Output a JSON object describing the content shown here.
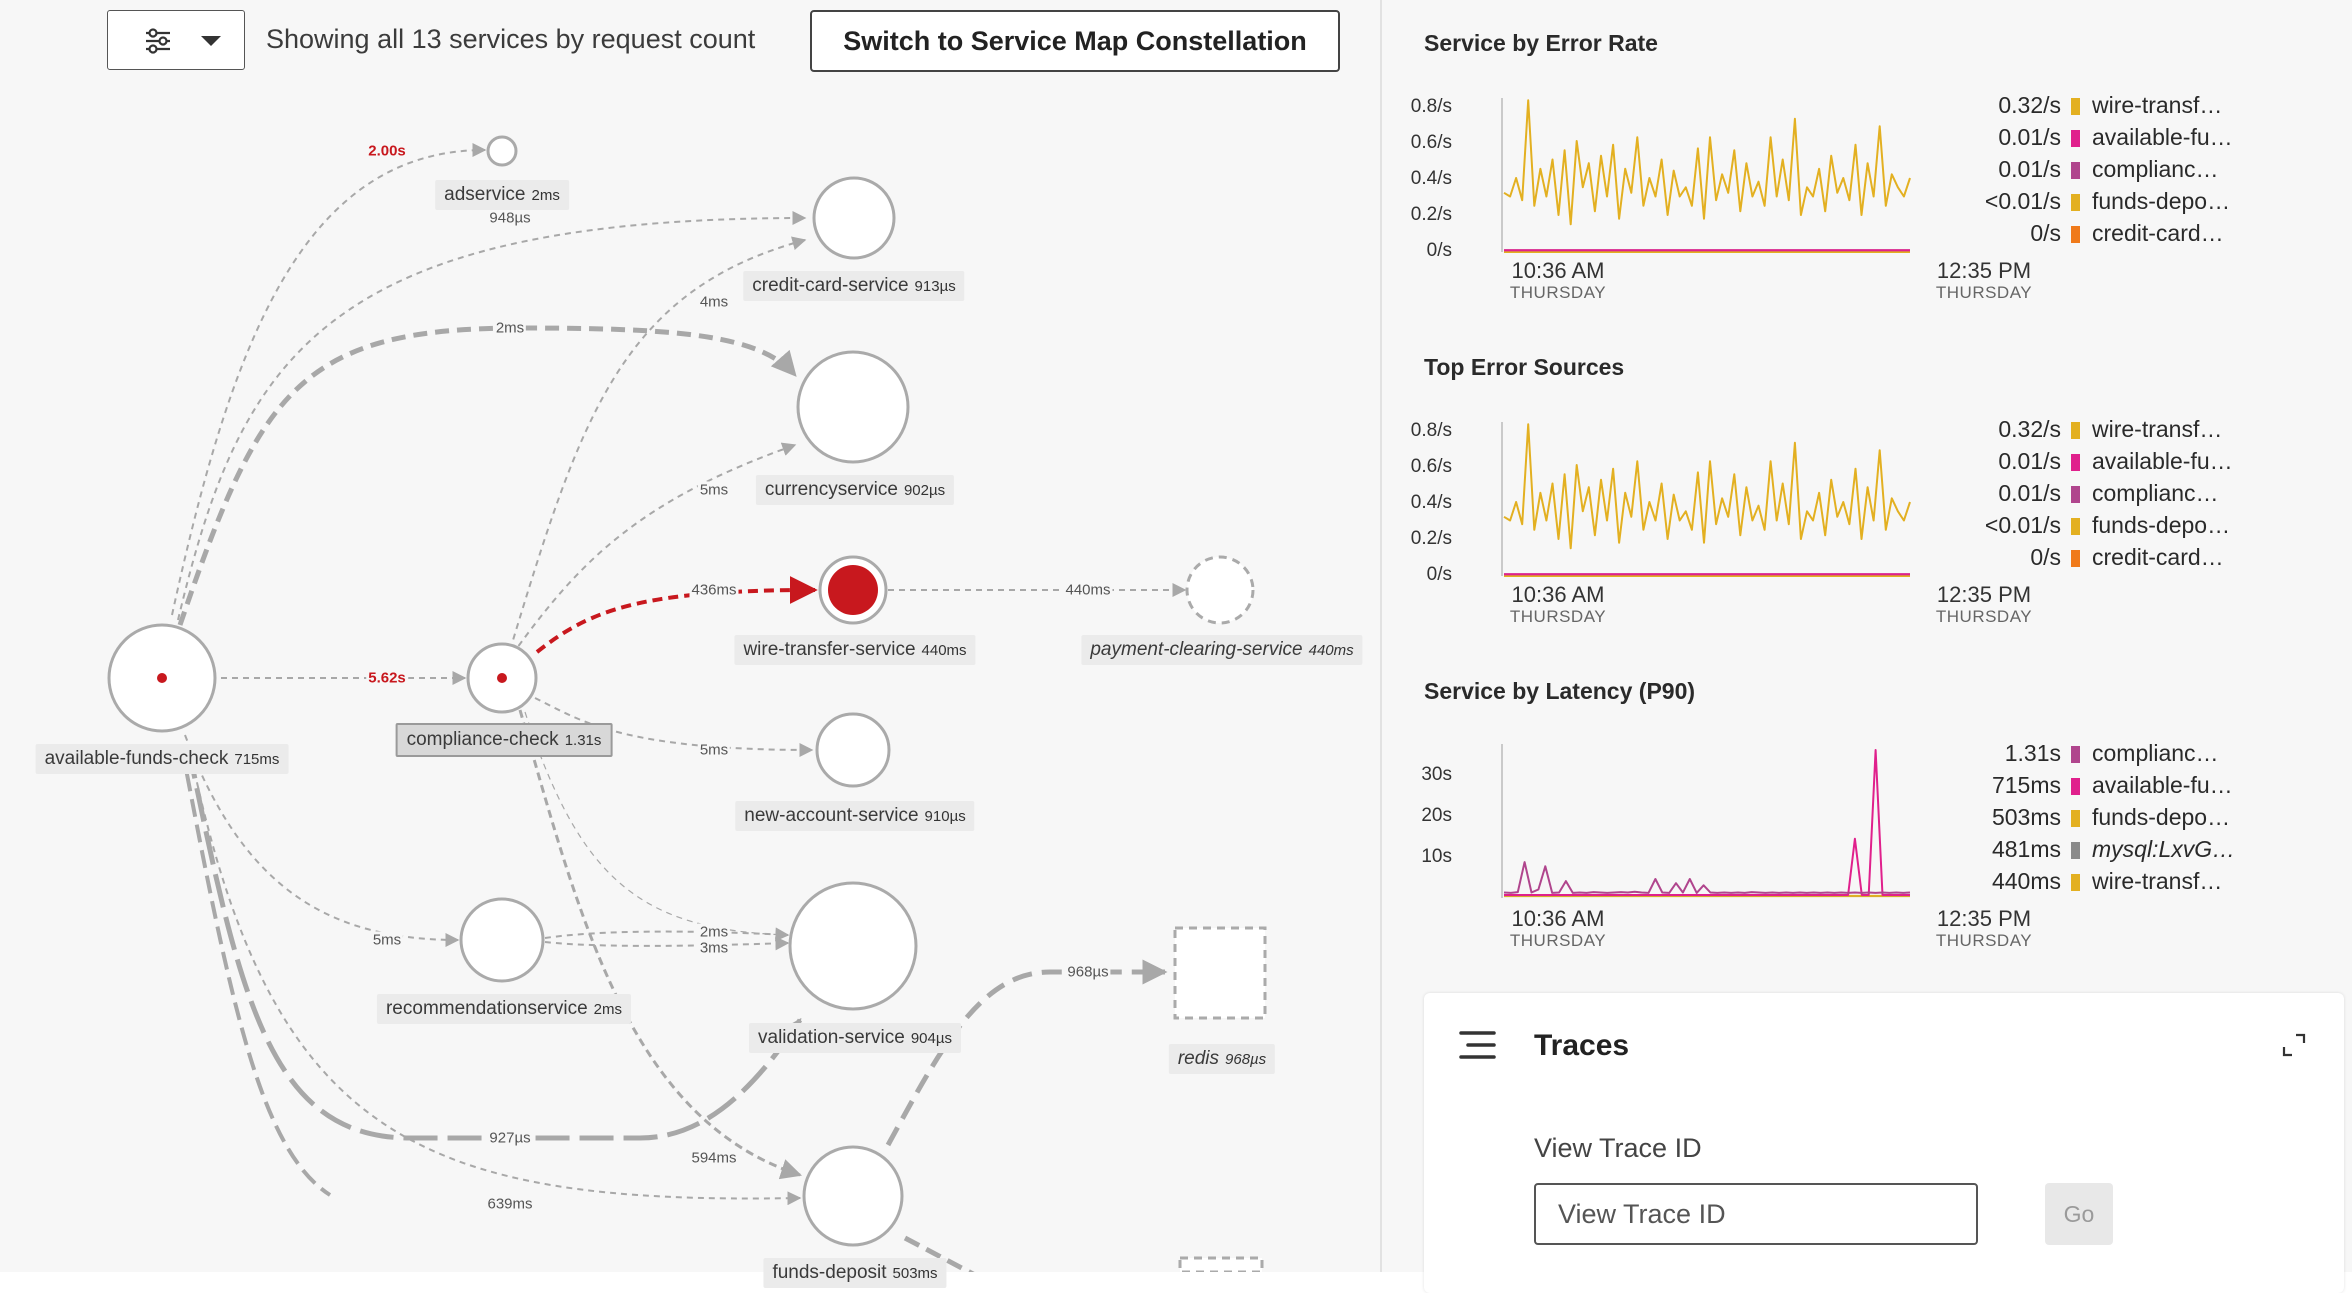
{
  "toolbar": {
    "showing_text": "Showing all 13 services by request count",
    "switch_label": "Switch to Service Map Constellation"
  },
  "service_map": {
    "nodes": {
      "adservice": {
        "name": "adservice",
        "latency": "2ms"
      },
      "credit_card": {
        "name": "credit-card-service",
        "latency": "913µs"
      },
      "currency": {
        "name": "currencyservice",
        "latency": "902µs"
      },
      "wire_transfer": {
        "name": "wire-transfer-service",
        "latency": "440ms"
      },
      "payment_clearing": {
        "name": "payment-clearing-service",
        "latency": "440ms"
      },
      "available_funds": {
        "name": "available-funds-check",
        "latency": "715ms"
      },
      "compliance": {
        "name": "compliance-check",
        "latency": "1.31s"
      },
      "new_account": {
        "name": "new-account-service",
        "latency": "910µs"
      },
      "recommendation": {
        "name": "recommendationservice",
        "latency": "2ms"
      },
      "validation": {
        "name": "validation-service",
        "latency": "904µs"
      },
      "redis": {
        "name": "redis",
        "latency": "968µs"
      },
      "funds_deposit": {
        "name": "funds-deposit",
        "latency": "503ms"
      }
    },
    "edges": {
      "afc_ad": "2.00s",
      "afc_cc": "948µs",
      "afc_cur": "2ms",
      "comp_cc": "4ms",
      "comp_cur": "5ms",
      "comp_wire": "436ms",
      "wire_pay": "440ms",
      "afc_comp": "5.62s",
      "comp_new": "5ms",
      "afc_rec": "5ms",
      "rec_val1": "2ms",
      "rec_val2": "3ms",
      "afc_val": "927µs",
      "fd_redis": "968µs",
      "comp_fd": "594ms",
      "afc_fd": "639ms"
    }
  },
  "charts": {
    "error_rate": {
      "title": "Service by Error Rate",
      "legend": [
        {
          "value": "0.32/s",
          "name": "wire-transf…",
          "color": "#e3b021"
        },
        {
          "value": "0.01/s",
          "name": "available-fu…",
          "color": "#e0208c"
        },
        {
          "value": "0.01/s",
          "name": "complianc…",
          "color": "#b0458d"
        },
        {
          "value": "<0.01/s",
          "name": "funds-depo…",
          "color": "#e3b021"
        },
        {
          "value": "0/s",
          "name": "credit-card…",
          "color": "#f07a1a"
        }
      ]
    },
    "top_errors": {
      "title": "Top Error Sources",
      "legend": [
        {
          "value": "0.32/s",
          "name": "wire-transf…",
          "color": "#e3b021"
        },
        {
          "value": "0.01/s",
          "name": "available-fu…",
          "color": "#e0208c"
        },
        {
          "value": "0.01/s",
          "name": "complianc…",
          "color": "#b0458d"
        },
        {
          "value": "<0.01/s",
          "name": "funds-depo…",
          "color": "#e3b021"
        },
        {
          "value": "0/s",
          "name": "credit-card…",
          "color": "#f07a1a"
        }
      ]
    },
    "latency": {
      "title": "Service by Latency (P90)",
      "legend": [
        {
          "value": "1.31s",
          "name": "complianc…",
          "color": "#b0458d"
        },
        {
          "value": "715ms",
          "name": "available-fu…",
          "color": "#e0208c"
        },
        {
          "value": "503ms",
          "name": "funds-depo…",
          "color": "#e3b021"
        },
        {
          "value": "481ms",
          "name": "mysql:LxvG…",
          "color": "#8a8a8a"
        },
        {
          "value": "440ms",
          "name": "wire-transf…",
          "color": "#e3b021"
        }
      ]
    },
    "x_start": "10:36 AM",
    "x_start_day": "THURSDAY",
    "x_end": "12:35 PM",
    "x_end_day": "THURSDAY"
  },
  "chart_data": [
    {
      "type": "line",
      "title": "Service by Error Rate",
      "ylabel": "",
      "ylim": [
        0,
        0.8
      ],
      "yticks": [
        "0/s",
        "0.2/s",
        "0.4/s",
        "0.6/s",
        "0.8/s"
      ],
      "x": [
        "10:36 AM",
        "12:35 PM"
      ],
      "series": [
        {
          "name": "wire-transf…",
          "color": "#e3b021",
          "values": [
            0.32,
            0.3,
            0.4,
            0.28,
            0.82,
            0.25,
            0.45,
            0.3,
            0.5,
            0.2,
            0.55,
            0.15,
            0.6,
            0.35,
            0.48,
            0.22,
            0.52,
            0.3,
            0.58,
            0.18,
            0.45,
            0.32,
            0.62,
            0.25,
            0.4,
            0.3,
            0.5,
            0.2,
            0.44,
            0.3,
            0.35,
            0.25,
            0.56,
            0.18,
            0.62,
            0.28,
            0.42,
            0.32,
            0.55,
            0.22,
            0.48,
            0.3,
            0.38,
            0.25,
            0.62,
            0.3,
            0.5,
            0.28,
            0.72,
            0.2,
            0.35,
            0.3,
            0.45,
            0.22,
            0.52,
            0.32,
            0.4,
            0.28,
            0.58,
            0.2,
            0.48,
            0.3,
            0.68,
            0.25,
            0.42,
            0.35,
            0.3,
            0.4
          ]
        },
        {
          "name": "available-fu…",
          "color": "#e0208c",
          "values": [
            0.01,
            0.01,
            0.01,
            0.01
          ]
        },
        {
          "name": "complianc…",
          "color": "#b0458d",
          "values": [
            0.01,
            0.01,
            0.01,
            0.01
          ]
        },
        {
          "name": "funds-depo…",
          "color": "#e3b021",
          "values": [
            0.0,
            0.0,
            0.0,
            0.0
          ]
        },
        {
          "name": "credit-card…",
          "color": "#f07a1a",
          "values": [
            0,
            0,
            0,
            0
          ]
        }
      ]
    },
    {
      "type": "line",
      "title": "Top Error Sources",
      "ylabel": "",
      "ylim": [
        0,
        0.8
      ],
      "yticks": [
        "0/s",
        "0.2/s",
        "0.4/s",
        "0.6/s",
        "0.8/s"
      ],
      "x": [
        "10:36 AM",
        "12:35 PM"
      ],
      "series": [
        {
          "name": "wire-transf…",
          "color": "#e3b021",
          "values": [
            0.32,
            0.3,
            0.4,
            0.28,
            0.82,
            0.25,
            0.45,
            0.3,
            0.5,
            0.2,
            0.55,
            0.15,
            0.6,
            0.35,
            0.48,
            0.22,
            0.52,
            0.3,
            0.58,
            0.18,
            0.45,
            0.32,
            0.62,
            0.25,
            0.4,
            0.3,
            0.5,
            0.2,
            0.44,
            0.3,
            0.35,
            0.25,
            0.56,
            0.18,
            0.62,
            0.28,
            0.42,
            0.32,
            0.55,
            0.22,
            0.48,
            0.3,
            0.38,
            0.25,
            0.62,
            0.3,
            0.5,
            0.28,
            0.72,
            0.2,
            0.35,
            0.3,
            0.45,
            0.22,
            0.52,
            0.32,
            0.4,
            0.28,
            0.58,
            0.2,
            0.48,
            0.3,
            0.68,
            0.25,
            0.42,
            0.35,
            0.3,
            0.4
          ]
        },
        {
          "name": "available-fu…",
          "color": "#e0208c",
          "values": [
            0.01,
            0.01,
            0.01,
            0.01
          ]
        },
        {
          "name": "complianc…",
          "color": "#b0458d",
          "values": [
            0.01,
            0.01,
            0.01,
            0.01
          ]
        },
        {
          "name": "funds-depo…",
          "color": "#e3b021",
          "values": [
            0.0,
            0.0,
            0.0,
            0.0
          ]
        },
        {
          "name": "credit-card…",
          "color": "#f07a1a",
          "values": [
            0,
            0,
            0,
            0
          ]
        }
      ]
    },
    {
      "type": "line",
      "title": "Service by Latency (P90)",
      "ylabel": "",
      "ylim": [
        0,
        35
      ],
      "yticks": [
        "10s",
        "20s",
        "30s"
      ],
      "x": [
        "10:36 AM",
        "12:35 PM"
      ],
      "series": [
        {
          "name": "complianc…",
          "color": "#b0458d",
          "values": [
            1.3,
            1.2,
            1.4,
            8.5,
            1.3,
            2.0,
            7.5,
            1.2,
            1.3,
            4.0,
            1.2,
            1.3,
            1.2,
            1.4,
            1.3,
            1.2,
            1.3,
            1.4,
            1.3,
            1.5,
            1.3,
            1.2,
            4.5,
            1.3,
            1.2,
            3.5,
            1.3,
            4.5,
            1.2,
            3.0,
            1.3,
            1.2,
            1.3,
            1.2,
            1.3,
            1.2,
            1.4,
            1.3,
            1.2,
            1.3,
            1.2,
            1.3,
            1.2,
            1.3,
            1.2,
            1.3,
            1.2,
            1.3,
            1.2,
            1.3,
            1.2,
            1.3,
            1.2,
            1.3,
            1.2,
            1.3,
            1.2,
            1.3,
            1.2,
            1.3
          ]
        },
        {
          "name": "available-fu…",
          "color": "#e0208c",
          "values": [
            0.7,
            0.7,
            0.7,
            0.7,
            0.7,
            0.7,
            0.7,
            0.7,
            0.7,
            0.7,
            0.7,
            0.7,
            0.7,
            0.7,
            0.7,
            0.7,
            0.7,
            0.7,
            0.7,
            0.7,
            0.7,
            0.7,
            0.7,
            0.7,
            0.7,
            0.7,
            0.7,
            0.7,
            0.7,
            0.7,
            0.7,
            0.7,
            0.7,
            0.7,
            0.7,
            0.7,
            0.7,
            0.7,
            0.7,
            0.7,
            0.7,
            0.7,
            0.7,
            0.7,
            0.7,
            0.7,
            0.7,
            0.7,
            0.7,
            0.7,
            0.7,
            14.0,
            0.7,
            0.7,
            35.0,
            0.7,
            0.7,
            0.7,
            0.7,
            0.7
          ]
        },
        {
          "name": "funds-depo…",
          "color": "#e3b021",
          "values": [
            0.5,
            0.5,
            0.5,
            0.5
          ]
        },
        {
          "name": "mysql:LxvG…",
          "color": "#8a8a8a",
          "values": [
            0.48,
            0.48,
            0.48,
            0.48
          ]
        },
        {
          "name": "wire-transf…",
          "color": "#e3b021",
          "values": [
            0.44,
            0.44,
            0.44,
            0.44
          ]
        }
      ]
    }
  ],
  "traces": {
    "title": "Traces",
    "view_label": "View Trace ID",
    "input_placeholder": "View Trace ID",
    "go_label": "Go"
  }
}
